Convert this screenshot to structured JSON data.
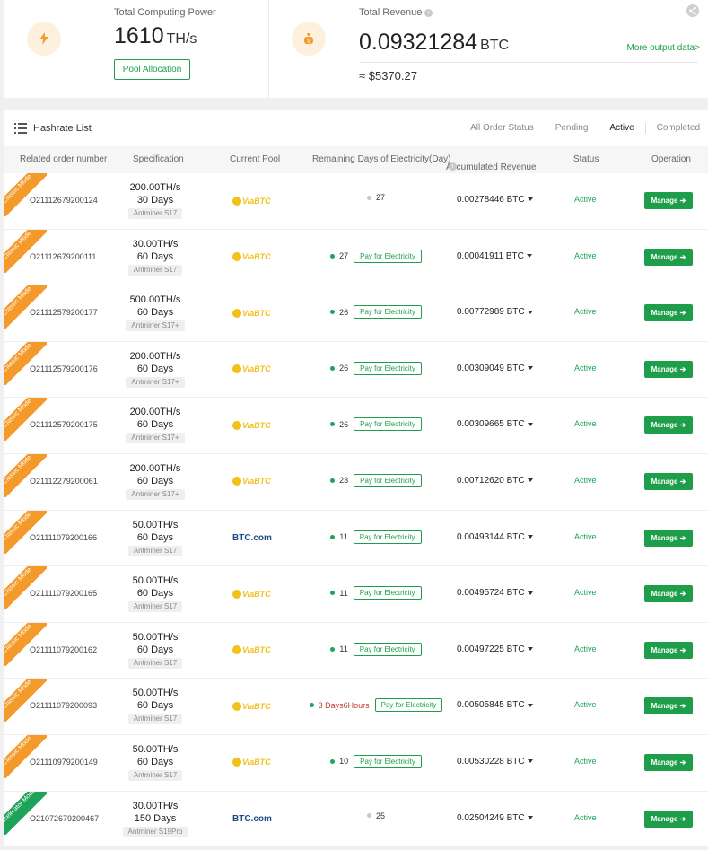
{
  "summary": {
    "computing_label": "Total Computing Power",
    "computing_value": "1610",
    "computing_unit": "TH/s",
    "pool_allocation_label": "Pool Allocation",
    "revenue_label": "Total Revenue",
    "revenue_value": "0.09321284",
    "revenue_unit": "BTC",
    "revenue_usd": "≈ $5370.27",
    "more_output_label": "More output data>",
    "icons": [
      "lightning-icon",
      "money-bag-icon",
      "info-icon",
      "share-icon"
    ]
  },
  "list": {
    "title": "Hashrate List",
    "filters": [
      "All Order Status",
      "Pending",
      "Active",
      "Completed"
    ],
    "active_filter": "Active",
    "columns": [
      "Related order number",
      "Specification",
      "Current Pool",
      "Remaining Days of Electricity(Day)",
      "Accumulated Revenue",
      "Status",
      "Operation"
    ],
    "pay_label": "Pay for Electricity",
    "manage_label": "Manage ➔",
    "rows": [
      {
        "mode": "Classic Mode",
        "order": "O21112679200124",
        "hashrate": "200.00TH/s",
        "duration": "30 Days",
        "model": "Antminer S17",
        "pool": "ViaBTC",
        "days": "27",
        "pay": false,
        "revenue": "0.00278446 BTC",
        "status": "Active"
      },
      {
        "mode": "Classic Mode",
        "order": "O21112679200111",
        "hashrate": "30.00TH/s",
        "duration": "60 Days",
        "model": "Antminer S17",
        "pool": "ViaBTC",
        "days": "27",
        "pay": true,
        "revenue": "0.00041911 BTC",
        "status": "Active"
      },
      {
        "mode": "Classic Mode",
        "order": "O21112579200177",
        "hashrate": "500.00TH/s",
        "duration": "60 Days",
        "model": "Antminer S17+",
        "pool": "ViaBTC",
        "days": "26",
        "pay": true,
        "revenue": "0.00772989 BTC",
        "status": "Active"
      },
      {
        "mode": "Classic Mode",
        "order": "O21112579200176",
        "hashrate": "200.00TH/s",
        "duration": "60 Days",
        "model": "Antminer S17+",
        "pool": "ViaBTC",
        "days": "26",
        "pay": true,
        "revenue": "0.00309049 BTC",
        "status": "Active"
      },
      {
        "mode": "Classic Mode",
        "order": "O21112579200175",
        "hashrate": "200.00TH/s",
        "duration": "60 Days",
        "model": "Antminer S17+",
        "pool": "ViaBTC",
        "days": "26",
        "pay": true,
        "revenue": "0.00309665 BTC",
        "status": "Active"
      },
      {
        "mode": "Classic Mode",
        "order": "O21112279200061",
        "hashrate": "200.00TH/s",
        "duration": "60 Days",
        "model": "Antminer S17+",
        "pool": "ViaBTC",
        "days": "23",
        "pay": true,
        "revenue": "0.00712620 BTC",
        "status": "Active"
      },
      {
        "mode": "Classic Mode",
        "order": "O21111079200166",
        "hashrate": "50.00TH/s",
        "duration": "60 Days",
        "model": "Antminer S17",
        "pool": "BTC.com",
        "days": "11",
        "pay": true,
        "revenue": "0.00493144 BTC",
        "status": "Active"
      },
      {
        "mode": "Classic Mode",
        "order": "O21111079200165",
        "hashrate": "50.00TH/s",
        "duration": "60 Days",
        "model": "Antminer S17",
        "pool": "ViaBTC",
        "days": "11",
        "pay": true,
        "revenue": "0.00495724 BTC",
        "status": "Active"
      },
      {
        "mode": "Classic Mode",
        "order": "O21111079200162",
        "hashrate": "50.00TH/s",
        "duration": "60 Days",
        "model": "Antminer S17",
        "pool": "ViaBTC",
        "days": "11",
        "pay": true,
        "revenue": "0.00497225 BTC",
        "status": "Active"
      },
      {
        "mode": "Classic Mode",
        "order": "O21111079200093",
        "hashrate": "50.00TH/s",
        "duration": "60 Days",
        "model": "Antminer S17",
        "pool": "ViaBTC",
        "days": "3 Days6Hours",
        "warn": true,
        "pay": true,
        "revenue": "0.00505845 BTC",
        "status": "Active"
      },
      {
        "mode": "Classic Mode",
        "order": "O21110979200149",
        "hashrate": "50.00TH/s",
        "duration": "60 Days",
        "model": "Antminer S17",
        "pool": "ViaBTC",
        "days": "10",
        "pay": true,
        "revenue": "0.00530228 BTC",
        "status": "Active"
      },
      {
        "mode": "Accelerator Mode",
        "order": "O21072679200467",
        "hashrate": "30.00TH/s",
        "duration": "150 Days",
        "model": "Antminer S19Pro",
        "pool": "BTC.com",
        "days": "25",
        "pay": false,
        "revenue": "0.02504249 BTC",
        "status": "Active"
      }
    ]
  }
}
